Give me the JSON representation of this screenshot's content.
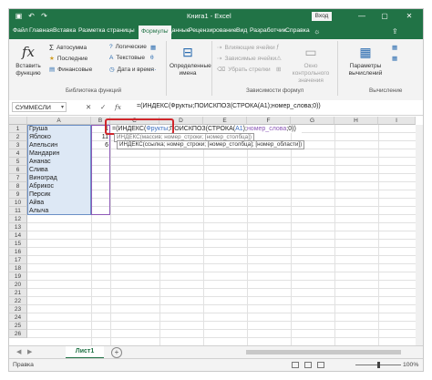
{
  "window": {
    "title": "Книга1 - Excel",
    "signin": "Вход",
    "minimize": "—",
    "restore": "▢",
    "close": "✕"
  },
  "qat": {
    "save_icon": "save-icon",
    "undo": "↶",
    "redo": "↷"
  },
  "tabs": [
    "Файл",
    "Главная",
    "Вставка",
    "Разметка страницы",
    "Формулы",
    "Данные",
    "Рецензирование",
    "Вид",
    "Разработчик",
    "Справка"
  ],
  "active_tab": "Формулы",
  "ribbon": {
    "insert_function": {
      "label": "Вставить функцию",
      "icon": "fx"
    },
    "library_rows": [
      {
        "label": "Автосумма",
        "icon": "sum-icon",
        "dim": false
      },
      {
        "label": "Последние",
        "icon": "star-icon",
        "dim": false
      },
      {
        "label": "Финансовые",
        "icon": "book-icon",
        "dim": false
      },
      {
        "label": "Логические",
        "icon": "question-icon",
        "dim": false
      },
      {
        "label": "Текстовые",
        "icon": "text-icon",
        "dim": false
      },
      {
        "label": "Дата и время",
        "icon": "clock-icon",
        "dim": false
      }
    ],
    "library_group": "Библиотека функций",
    "defined_names": {
      "label": "Определенные имена"
    },
    "audit_rows": [
      {
        "label": "Влияющие ячейки",
        "dim": true
      },
      {
        "label": "Зависимые ячейки",
        "dim": true
      },
      {
        "label": "Убрать стрелки",
        "dim": true
      }
    ],
    "watch_window": {
      "label": "Окно контрольного значения"
    },
    "audit_group": "Зависимости формул",
    "calc_options": {
      "label": "Параметры вычислений"
    },
    "calc_group": "Вычисление"
  },
  "formula_bar": {
    "name_box": "СУММЕСЛИ",
    "cancel": "✕",
    "enter": "✓",
    "fx": "fx",
    "formula": "=(ИНДЕКС(Фрукты;ПОИСКПОЗ(СТРОКА(A1);номер_слова;0))"
  },
  "grid": {
    "columns": [
      "A",
      "B",
      "C",
      "D",
      "E",
      "F",
      "G",
      "H",
      "I",
      "J"
    ],
    "rows": [
      "1",
      "2",
      "3",
      "4",
      "5",
      "6",
      "7",
      "8",
      "9",
      "10",
      "11",
      "12",
      "13",
      "14",
      "15",
      "16",
      "17",
      "18",
      "19",
      "20",
      "21",
      "22",
      "23",
      "24",
      "25",
      "26"
    ],
    "fruits": [
      "Груша",
      "Яблоко",
      "Апельсин",
      "Мандарин",
      "Ананас",
      "Слива",
      "Виноград",
      "Абрикос",
      "Персик",
      "Айва",
      "Алыча"
    ],
    "b_values": [
      "1",
      "11",
      "6",
      "",
      "",
      "",
      "",
      "",
      "",
      "",
      ""
    ],
    "edit_text": {
      "prefix": "=(ИНДЕКС(",
      "arg1": "Фрукты",
      "mid": ";ПОИСКПОЗ(СТРОКА(",
      "arg2": "A1",
      "mid2": ");",
      "arg3": "номер_слова",
      "end": ";0))"
    },
    "tooltip1": "ПОИСКПОЗ(искомое_значение; просматриваемый_массив; [тип_сопоставления])",
    "tooltip1_short": "ИНДЕКС(массив; номер_строки; [номер_столбца])",
    "tooltip2": "ИНДЕКС(ссылка; номер_строки; [номер_столбца]; [номер_области])"
  },
  "sheets": {
    "active": "Лист1",
    "add": "+"
  },
  "status": {
    "mode": "Правка",
    "zoom": "100%"
  }
}
